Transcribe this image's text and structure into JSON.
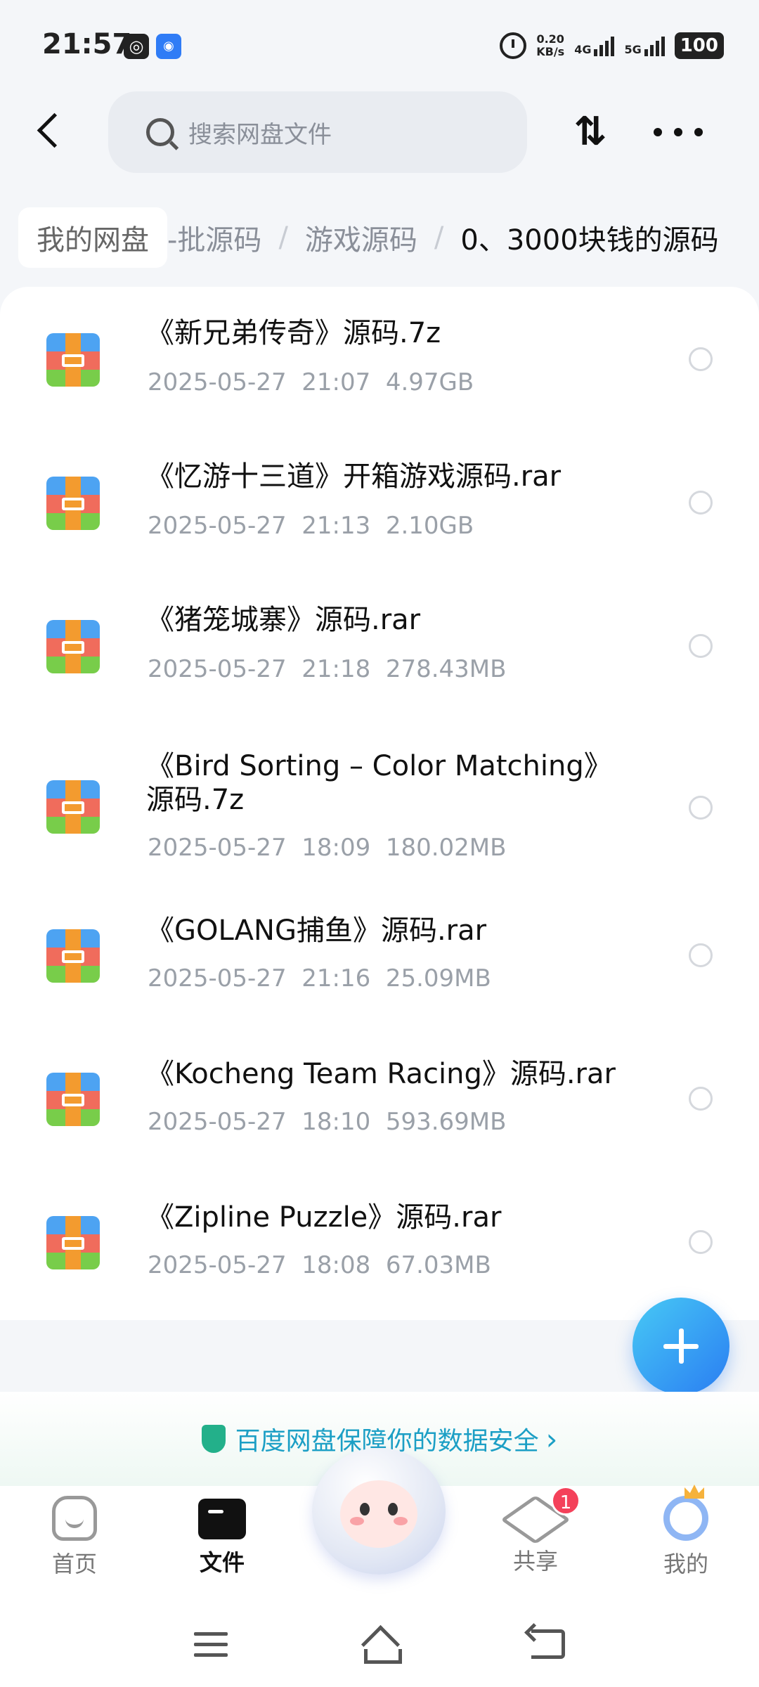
{
  "status": {
    "time": "21:57",
    "speed_value": "0.20",
    "speed_unit": "KB/s",
    "net1": "4G",
    "net2": "5G",
    "battery": "100"
  },
  "header": {
    "search_placeholder": "搜索网盘文件",
    "sort_icon": "⇅"
  },
  "breadcrumb": {
    "home": "我的网盘",
    "level1": "-批源码",
    "separator": "/",
    "level2": "游戏源码",
    "current": "0、3000块钱的源码"
  },
  "files": [
    {
      "name": "《新兄弟传奇》源码.7z",
      "date": "2025-05-27",
      "time": "21:07",
      "size": "4.97GB"
    },
    {
      "name": "《忆游十三道》开箱游戏源码.rar",
      "date": "2025-05-27",
      "time": "21:13",
      "size": "2.10GB"
    },
    {
      "name": "《猪笼城寨》源码.rar",
      "date": "2025-05-27",
      "time": "21:18",
      "size": "278.43MB"
    },
    {
      "name": "《Bird Sorting – Color Matching》源码.7z",
      "date": "2025-05-27",
      "time": "18:09",
      "size": "180.02MB"
    },
    {
      "name": "《GOLANG捕鱼》源码.rar",
      "date": "2025-05-27",
      "time": "21:16",
      "size": "25.09MB"
    },
    {
      "name": "《Kocheng Team Racing》源码.rar",
      "date": "2025-05-27",
      "time": "18:10",
      "size": "593.69MB"
    },
    {
      "name": "《Zipline Puzzle》源码.rar",
      "date": "2025-05-27",
      "time": "18:08",
      "size": "67.03MB"
    }
  ],
  "security_banner": "百度网盘保障你的数据安全",
  "security_chevron": "›",
  "tabs": {
    "home": "首页",
    "files": "文件",
    "share": "共享",
    "me": "我的",
    "share_badge": "1"
  },
  "colors": {
    "accent": "#2a7df2",
    "security_text": "#1c9fc5",
    "badge": "#f4415a"
  }
}
